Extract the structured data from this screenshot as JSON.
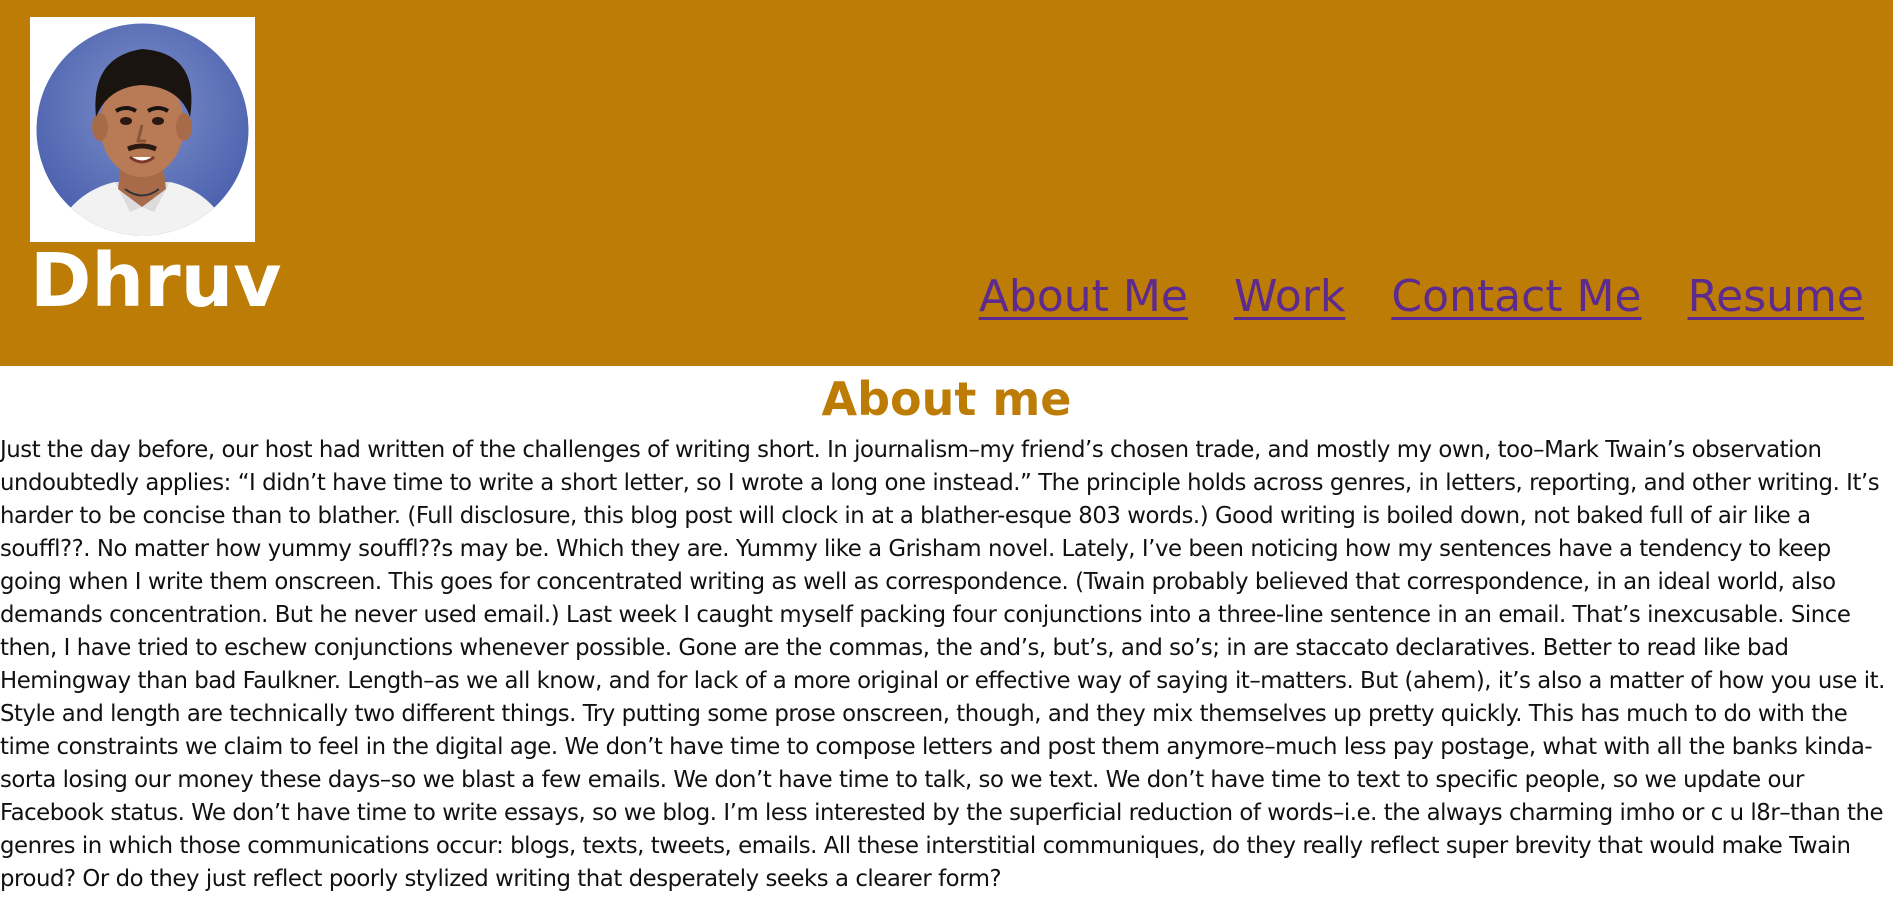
{
  "header": {
    "name": "Dhruv",
    "colors": {
      "background": "#bd7c06",
      "name_text": "#ffffff",
      "nav_link": "#5d2a8e"
    },
    "avatar_icon": "profile-photo"
  },
  "nav": {
    "items": [
      {
        "label": "About Me"
      },
      {
        "label": "Work"
      },
      {
        "label": "Contact Me"
      },
      {
        "label": "Resume"
      }
    ]
  },
  "about": {
    "title": "About me",
    "title_color": "#bd7c06",
    "body": "Just the day before, our host had written of the challenges of writing short. In journalism–my friend’s chosen trade, and mostly my own, too–Mark Twain’s observation undoubtedly applies: “I didn’t have time to write a short letter, so I wrote a long one instead.” The principle holds across genres, in letters, reporting, and other writing. It’s harder to be concise than to blather. (Full disclosure, this blog post will clock in at a blather-esque 803 words.) Good writing is boiled down, not baked full of air like a souffl??. No matter how yummy souffl??s may be. Which they are. Yummy like a Grisham novel. Lately, I’ve been noticing how my sentences have a tendency to keep going when I write them onscreen. This goes for concentrated writing as well as correspondence. (Twain probably believed that correspondence, in an ideal world, also demands concentration. But he never used email.) Last week I caught myself packing four conjunctions into a three-line sentence in an email. That’s inexcusable. Since then, I have tried to eschew conjunctions whenever possible. Gone are the commas, the and’s, but’s, and so’s; in are staccato declaratives. Better to read like bad Hemingway than bad Faulkner. Length–as we all know, and for lack of a more original or effective way of saying it–matters. But (ahem), it’s also a matter of how you use it. Style and length are technically two different things. Try putting some prose onscreen, though, and they mix themselves up pretty quickly. This has much to do with the time constraints we claim to feel in the digital age. We don’t have time to compose letters and post them anymore–much less pay postage, what with all the banks kinda-sorta losing our money these days–so we blast a few emails. We don’t have time to talk, so we text. We don’t have time to text to specific people, so we update our Facebook status. We don’t have time to write essays, so we blog. I’m less interested by the superficial reduction of words–i.e. the always charming imho or c u l8r–than the genres in which those communications occur: blogs, texts, tweets, emails. All these interstitial communiques, do they really reflect super brevity that would make Twain proud? Or do they just reflect poorly stylized writing that desperately seeks a clearer form?"
  }
}
